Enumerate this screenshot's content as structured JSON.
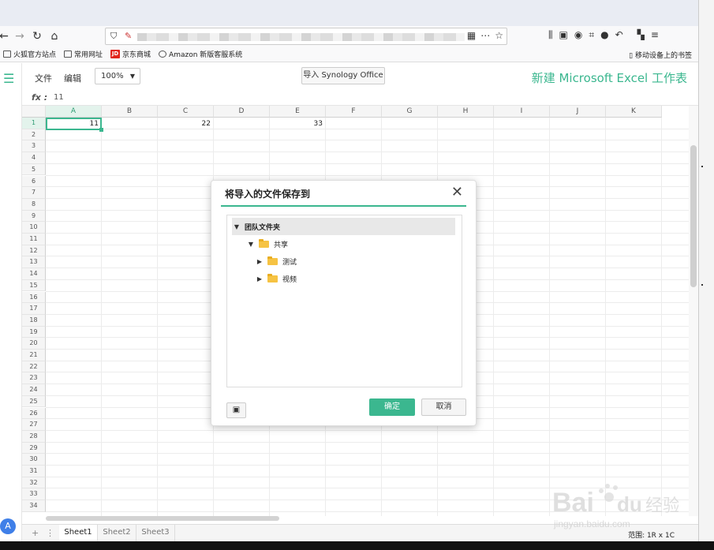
{
  "browser": {
    "bookmarks": [
      "火狐官方站点",
      "常用网址",
      "京东商城",
      "Amazon 新版客服系统"
    ],
    "bookmark_jd_badge": "JD",
    "mobile_bookmarks": "移动设备上的书签"
  },
  "app": {
    "menu_file": "文件",
    "menu_edit": "编辑",
    "zoom": "100%",
    "import_button": "导入 Synology Office",
    "doc_title": "新建 Microsoft Excel 工作表",
    "fx_label": "fx",
    "fx_value": "11",
    "avatar_letter": "A"
  },
  "sheet": {
    "columns": [
      "A",
      "B",
      "C",
      "D",
      "E",
      "F",
      "G",
      "H",
      "I",
      "J",
      "K"
    ],
    "rows": [
      "1",
      "2",
      "3",
      "4",
      "5",
      "6",
      "7",
      "8",
      "9",
      "10",
      "11",
      "12",
      "13",
      "14",
      "15",
      "16",
      "17",
      "18",
      "19",
      "20",
      "21",
      "22",
      "23",
      "24",
      "25",
      "26",
      "27",
      "28",
      "29",
      "30",
      "31",
      "32",
      "33",
      "34"
    ],
    "cell_a1": "11",
    "cell_c1": "22",
    "cell_e1": "33",
    "tabs": [
      "Sheet1",
      "Sheet2",
      "Sheet3"
    ],
    "range": "范围: 1R x 1C"
  },
  "dialog": {
    "title": "将导入的文件保存到",
    "root": "团队文件夹",
    "shared": "共享",
    "child1": "测试",
    "child2": "视频",
    "ok": "确定",
    "cancel": "取消"
  },
  "colors": {
    "accent": "#3bb78f"
  }
}
